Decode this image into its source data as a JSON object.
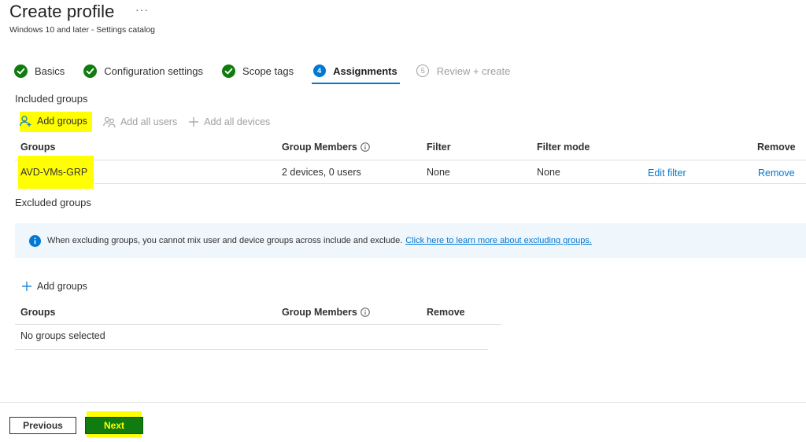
{
  "header": {
    "title": "Create profile",
    "more": "···",
    "subtitle": "Windows 10 and later - Settings catalog"
  },
  "steps": [
    {
      "label": "Basics",
      "state": "done"
    },
    {
      "label": "Configuration settings",
      "state": "done"
    },
    {
      "label": "Scope tags",
      "state": "done"
    },
    {
      "number": "4",
      "label": "Assignments",
      "state": "active"
    },
    {
      "number": "5",
      "label": "Review + create",
      "state": "disabled"
    }
  ],
  "included": {
    "section_label": "Included groups",
    "commands": {
      "add_groups": "Add groups",
      "add_all_users": "Add all users",
      "add_all_devices": "Add all devices"
    },
    "columns": {
      "groups": "Groups",
      "members": "Group Members",
      "filter": "Filter",
      "filter_mode": "Filter mode",
      "remove": "Remove"
    },
    "rows": [
      {
        "group": "AVD-VMs-GRP",
        "members": "2 devices, 0 users",
        "filter": "None",
        "filter_mode": "None",
        "edit_filter": "Edit filter",
        "remove": "Remove"
      }
    ]
  },
  "excluded": {
    "section_label": "Excluded groups",
    "info_text": "When excluding groups, you cannot mix user and device groups across include and exclude.",
    "info_link": "Click here to learn more about excluding groups.",
    "add_groups": "Add groups",
    "columns": {
      "groups": "Groups",
      "members": "Group Members",
      "remove": "Remove"
    },
    "empty_text": "No groups selected"
  },
  "footer": {
    "previous": "Previous",
    "next": "Next"
  },
  "colors": {
    "accent": "#0078d4",
    "success": "#107c10",
    "highlight": "#ffff00"
  }
}
